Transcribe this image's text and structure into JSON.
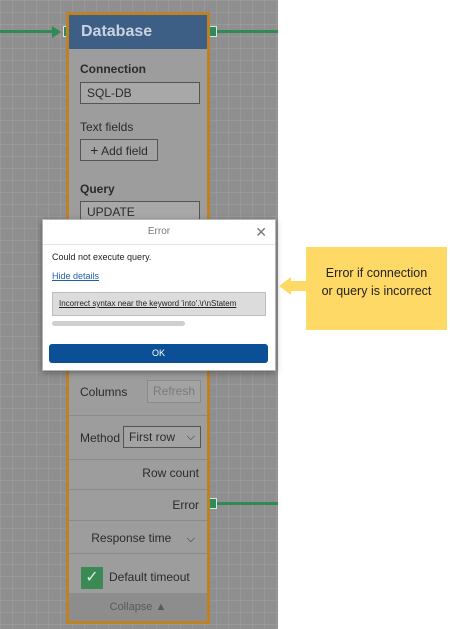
{
  "node": {
    "title": "Database",
    "connection_label": "Connection",
    "connection_value": "SQL-DB",
    "text_fields_label": "Text fields",
    "add_field_label": "Add field",
    "add_field_icon": "plus-icon",
    "query_label": "Query",
    "query_value": "UPDATE",
    "columns_label": "Columns",
    "refresh_label": "Refresh",
    "method_label": "Method",
    "method_value": "First row",
    "row_count_label": "Row count",
    "error_label": "Error",
    "response_time_label": "Response time",
    "default_timeout_label": "Default timeout",
    "default_timeout_checked": true,
    "collapse_label": "Collapse ▲"
  },
  "dialog": {
    "title": "Error",
    "message": "Could not execute query.",
    "details_link": "Hide details",
    "detail_text": "Incorrect syntax near the keyword 'into'.\\r\\nStatem",
    "ok_label": "OK"
  },
  "callout": {
    "line1": "Error if connection",
    "line2": "or query is incorrect"
  },
  "colors": {
    "accent_green": "#2f8a55",
    "node_border": "#bf8125",
    "header_blue": "#3d5f86",
    "ok_blue": "#0b4f96",
    "callout_yellow": "#ffd965"
  }
}
